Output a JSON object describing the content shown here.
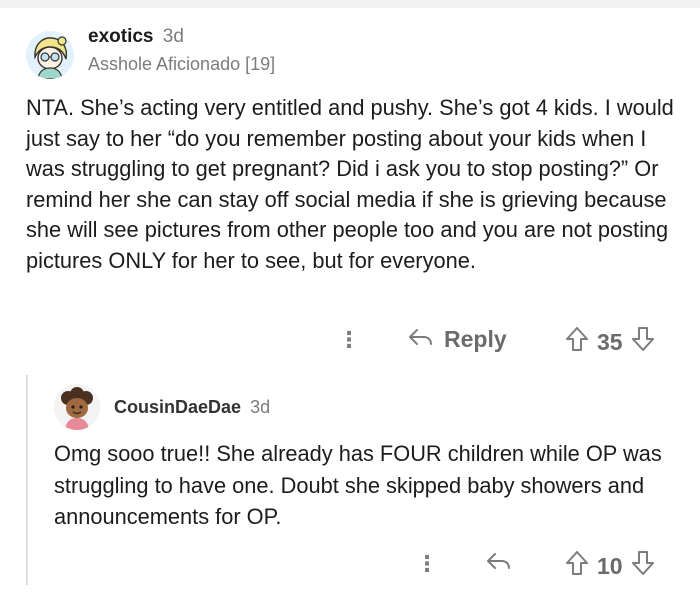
{
  "comment1": {
    "username": "exotics",
    "age": "3d",
    "flair": "Asshole Aficionado [19]",
    "body": "NTA. She’s acting very entitled and pushy.   She’s got 4 kids. I would just say to her “do you remember posting about your kids when I was struggling to get pregnant? Did i ask you to stop posting?” Or remind her she can stay off social media if she is grieving because she will see pictures from other people too and you are not posting pictures ONLY for her to see, but for everyone.",
    "more_icon": "⋮",
    "reply_label": "Reply",
    "score": "35"
  },
  "comment2": {
    "username": "CousinDaeDae",
    "age": "3d",
    "body": "Omg sooo true!! She already has FOUR children while OP was struggling to have one. Doubt she skipped baby showers and announcements for OP.",
    "more_icon": "⋮",
    "score": "10"
  }
}
